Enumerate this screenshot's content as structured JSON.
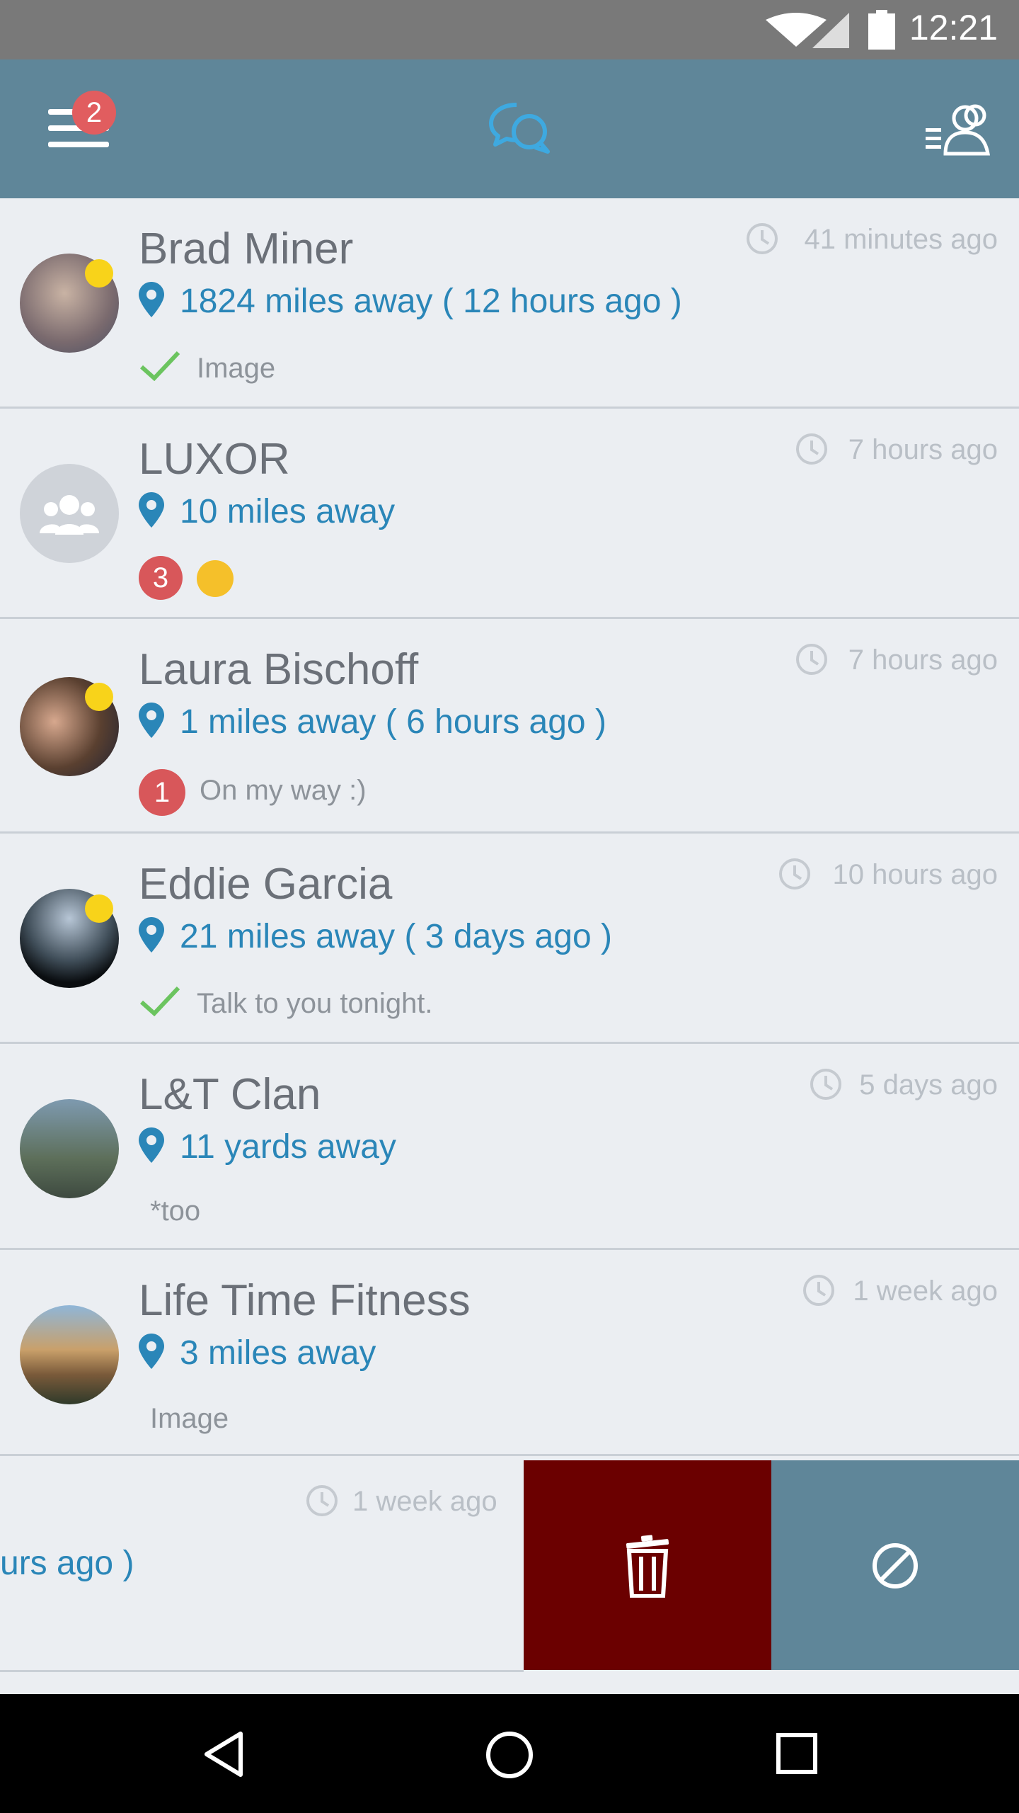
{
  "status": {
    "time": "12:21"
  },
  "header": {
    "menu_badge": "2"
  },
  "conversations": [
    {
      "name": "Brad Miner",
      "distance": "1824 miles away",
      "last_seen": "( 12 hours ago )",
      "time": "41 minutes ago",
      "snippet": "Image",
      "status_icon": "check-icon"
    },
    {
      "name": "LUXOR",
      "distance": "10 miles away",
      "last_seen": "",
      "time": "7 hours ago",
      "snippet": "",
      "badge": "3",
      "status_icon": "emoji-icon"
    },
    {
      "name": "Laura Bischoff",
      "distance": "1 miles away",
      "last_seen": "( 6 hours ago )",
      "time": "7 hours ago",
      "snippet": "On my way :)",
      "badge": "1"
    },
    {
      "name": "Eddie Garcia",
      "distance": "21 miles away",
      "last_seen": "( 3 days ago )",
      "time": "10 hours ago",
      "snippet": "Talk to you tonight.",
      "status_icon": "check-icon"
    },
    {
      "name": "L&T Clan",
      "distance": "11 yards away",
      "last_seen": "",
      "time": "5 days ago",
      "snippet": "*too"
    },
    {
      "name": "Life Time Fitness",
      "distance": "3 miles away",
      "last_seen": "",
      "time": "1 week ago",
      "snippet": "Image"
    }
  ],
  "swiped_row": {
    "time": "1 week ago",
    "partial_text": "urs ago )"
  },
  "colors": {
    "appbar": "#5f8699",
    "accent": "#2a86b8",
    "delete": "#6b0000"
  }
}
